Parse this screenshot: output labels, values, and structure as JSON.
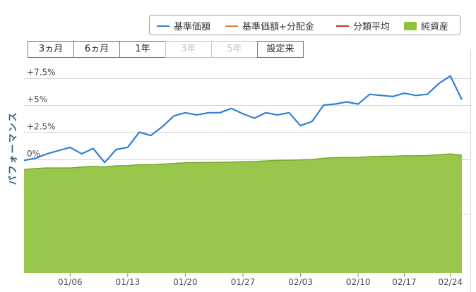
{
  "legend": {
    "items": [
      {
        "label": "基準価額",
        "color": "#2f80d6",
        "kind": "line"
      },
      {
        "label": "基準価額+分配金",
        "color": "#f07b29",
        "kind": "line"
      },
      {
        "label": "分類平均",
        "color": "#c0392b",
        "kind": "line"
      },
      {
        "label": "純資産",
        "color": "#8fc23c",
        "kind": "area"
      }
    ]
  },
  "period_buttons": [
    {
      "label": "3ヵ月",
      "enabled": true
    },
    {
      "label": "6ヵ月",
      "enabled": true
    },
    {
      "label": "1年",
      "enabled": true
    },
    {
      "label": "3年",
      "enabled": false
    },
    {
      "label": "5年",
      "enabled": false
    },
    {
      "label": "設定来",
      "enabled": true
    }
  ],
  "chart_data": {
    "type": "line",
    "ylabel": "パフォーマンス",
    "ylim": [
      -10.5,
      9.5
    ],
    "y_ticks": [
      {
        "value": 7.5,
        "label": "+7.5%"
      },
      {
        "value": 5,
        "label": "+5%"
      },
      {
        "value": 2.5,
        "label": "+2.5%"
      },
      {
        "value": 0,
        "label": "0%"
      }
    ],
    "grid": true,
    "legend_position": "top-right",
    "x_tick_labels": [
      {
        "label": "01/06",
        "index": 4
      },
      {
        "label": "01/13",
        "index": 9
      },
      {
        "label": "01/20",
        "index": 14
      },
      {
        "label": "01/27",
        "index": 19
      },
      {
        "label": "02/03",
        "index": 24
      },
      {
        "label": "02/10",
        "index": 29
      },
      {
        "label": "02/17",
        "index": 33
      },
      {
        "label": "02/24",
        "index": 37
      }
    ],
    "series": [
      {
        "name": "基準価額",
        "color": "#2f80d6",
        "values": [
          -0.1,
          0.1,
          0.5,
          0.8,
          1.1,
          0.5,
          1.0,
          -0.3,
          0.9,
          1.1,
          2.5,
          2.2,
          3.0,
          4.0,
          4.3,
          4.1,
          4.3,
          4.3,
          4.7,
          4.2,
          3.8,
          4.3,
          4.1,
          4.3,
          3.1,
          3.5,
          5.0,
          5.1,
          5.3,
          5.1,
          6.0,
          5.9,
          5.8,
          6.1,
          5.9,
          6.0,
          7.0,
          7.7,
          5.5
        ]
      },
      {
        "name": "純資産",
        "color": "#8fc23c",
        "values": [
          -0.95,
          -0.85,
          -0.8,
          -0.8,
          -0.8,
          -0.72,
          -0.65,
          -0.7,
          -0.6,
          -0.58,
          -0.5,
          -0.5,
          -0.45,
          -0.38,
          -0.32,
          -0.3,
          -0.3,
          -0.28,
          -0.25,
          -0.22,
          -0.2,
          -0.15,
          -0.1,
          -0.08,
          -0.05,
          -0.02,
          0.1,
          0.15,
          0.18,
          0.18,
          0.25,
          0.28,
          0.28,
          0.32,
          0.32,
          0.35,
          0.42,
          0.5,
          0.38
        ]
      }
    ]
  }
}
